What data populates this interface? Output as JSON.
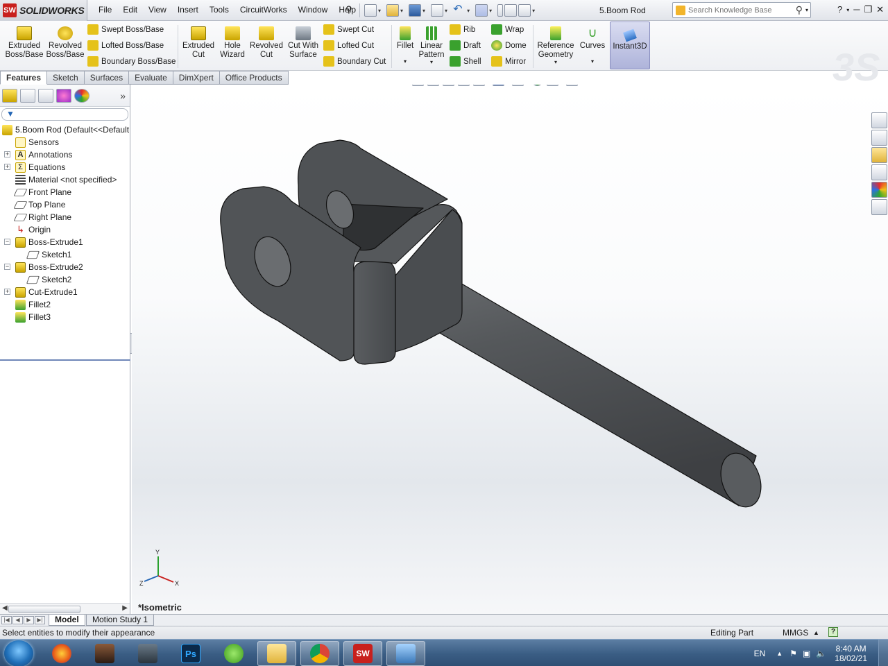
{
  "app": {
    "brand": "SOLIDWORKS",
    "doc_title": "5.Boom Rod"
  },
  "menu": [
    "File",
    "Edit",
    "View",
    "Insert",
    "Tools",
    "CircuitWorks",
    "Window",
    "Help"
  ],
  "search": {
    "placeholder": "Search Knowledge Base"
  },
  "commands": {
    "extruded_boss": "Extruded Boss/Base",
    "revolved_boss": "Revolved Boss/Base",
    "swept_boss": "Swept Boss/Base",
    "lofted_boss": "Lofted Boss/Base",
    "boundary_boss": "Boundary Boss/Base",
    "extruded_cut": "Extruded Cut",
    "hole_wizard": "Hole Wizard",
    "revolved_cut": "Revolved Cut",
    "cut_with_surface": "Cut With Surface",
    "swept_cut": "Swept Cut",
    "lofted_cut": "Lofted Cut",
    "boundary_cut": "Boundary Cut",
    "fillet": "Fillet",
    "linear_pattern": "Linear Pattern",
    "rib": "Rib",
    "draft": "Draft",
    "shell": "Shell",
    "wrap": "Wrap",
    "dome": "Dome",
    "mirror": "Mirror",
    "reference_geometry": "Reference Geometry",
    "curves": "Curves",
    "instant3d": "Instant3D"
  },
  "tabs": [
    "Features",
    "Sketch",
    "Surfaces",
    "Evaluate",
    "DimXpert",
    "Office Products"
  ],
  "tree": {
    "root": "5.Boom Rod  (Default<<Default",
    "items": [
      {
        "label": "Sensors"
      },
      {
        "label": "Annotations"
      },
      {
        "label": "Equations"
      },
      {
        "label": "Material <not specified>"
      },
      {
        "label": "Front Plane"
      },
      {
        "label": "Top Plane"
      },
      {
        "label": "Right Plane"
      },
      {
        "label": "Origin"
      },
      {
        "label": "Boss-Extrude1"
      },
      {
        "label": "Sketch1"
      },
      {
        "label": "Boss-Extrude2"
      },
      {
        "label": "Sketch2"
      },
      {
        "label": "Cut-Extrude1"
      },
      {
        "label": "Fillet2"
      },
      {
        "label": "Fillet3"
      }
    ]
  },
  "viewport": {
    "view_label": "*Isometric",
    "triad": {
      "y": "Y",
      "x": "X",
      "z": "Z"
    }
  },
  "bottom_tabs": [
    "Model",
    "Motion Study 1"
  ],
  "status": {
    "message": "Select entities to modify their appearance",
    "mode": "Editing Part",
    "units": "MMGS"
  },
  "taskbar": {
    "lang": "EN",
    "time": "8:40 AM",
    "date": "18/02/21"
  },
  "colors": {
    "part": "#4d5053",
    "accent": "#c8201d",
    "selection": "#aeb3da"
  }
}
